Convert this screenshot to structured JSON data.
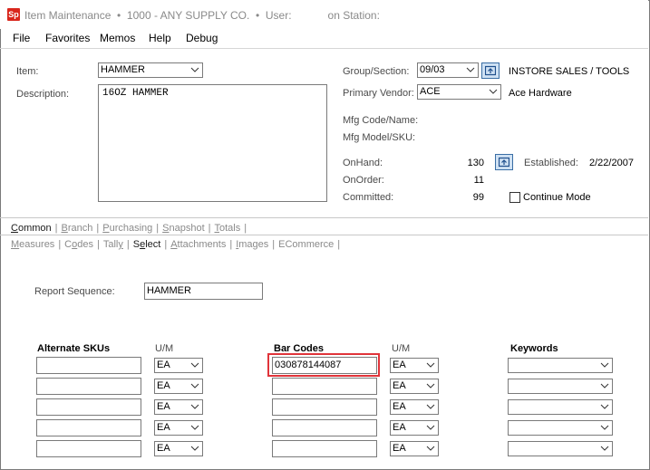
{
  "title": {
    "app_icon": "Sp",
    "text": "Item Maintenance  •  1000 - ANY SUPPLY CO.  •  User:            on Station:"
  },
  "menu": [
    "File",
    "Favorites",
    "Memos",
    "Help",
    "Debug"
  ],
  "item": {
    "item_label": "Item:",
    "item_value": "HAMMER",
    "description_label": "Description:",
    "description_value": "16OZ HAMMER"
  },
  "info": {
    "group_label": "Group/Section:",
    "group_value": "09/03",
    "group_desc": "INSTORE SALES / TOOLS",
    "vendor_label": "Primary Vendor:",
    "vendor_value": "ACE",
    "vendor_desc": "Ace Hardware",
    "mfg_code_label": "Mfg Code/Name:",
    "mfg_model_label": "Mfg Model/SKU:",
    "onhand_label": "OnHand:",
    "onhand_value": "130",
    "onorder_label": "OnOrder:",
    "onorder_value": "11",
    "committed_label": "Committed:",
    "committed_value": "99",
    "established_label": "Established:",
    "established_value": "2/22/2007",
    "continue_label": "Continue Mode"
  },
  "tabs1": [
    {
      "u": "C",
      "rest": "ommon",
      "active": true
    },
    {
      "u": "B",
      "rest": "ranch",
      "active": false
    },
    {
      "u": "P",
      "rest": "urchasing",
      "active": false
    },
    {
      "u": "S",
      "rest": "napshot",
      "active": false
    },
    {
      "u": "T",
      "rest": "otals",
      "active": false
    }
  ],
  "tabs2": [
    {
      "pre": "",
      "u": "M",
      "rest": "easures",
      "active": false
    },
    {
      "pre": "C",
      "u": "o",
      "rest": "des",
      "active": false
    },
    {
      "pre": "Tall",
      "u": "y",
      "rest": "",
      "active": false
    },
    {
      "pre": "S",
      "u": "e",
      "rest": "lect",
      "active": true
    },
    {
      "pre": "",
      "u": "A",
      "rest": "ttachments",
      "active": false
    },
    {
      "pre": "",
      "u": "I",
      "rest": "mages",
      "active": false
    },
    {
      "pre": "ECommerce",
      "u": "",
      "rest": "",
      "active": false
    }
  ],
  "report": {
    "label": "Report Sequence:",
    "value": "HAMMER"
  },
  "grid": {
    "alt_skus_header": "Alternate SKUs",
    "um_header": "U/M",
    "barcodes_header": "Bar Codes",
    "keywords_header": "Keywords",
    "alt_sku_values": [
      "",
      "",
      "",
      "",
      ""
    ],
    "alt_um_values": [
      "EA",
      "EA",
      "EA",
      "EA",
      "EA"
    ],
    "barcode_values": [
      "030878144087",
      "",
      "",
      "",
      ""
    ],
    "bar_um_values": [
      "EA",
      "EA",
      "EA",
      "EA",
      "EA"
    ],
    "keyword_values": [
      "",
      "",
      "",
      "",
      ""
    ]
  },
  "colors": {
    "highlight": "#e0343a",
    "icon_button_fill": "#cfe1f3",
    "icon_button_border": "#3a6ea5",
    "app_icon": "#d9261c"
  }
}
